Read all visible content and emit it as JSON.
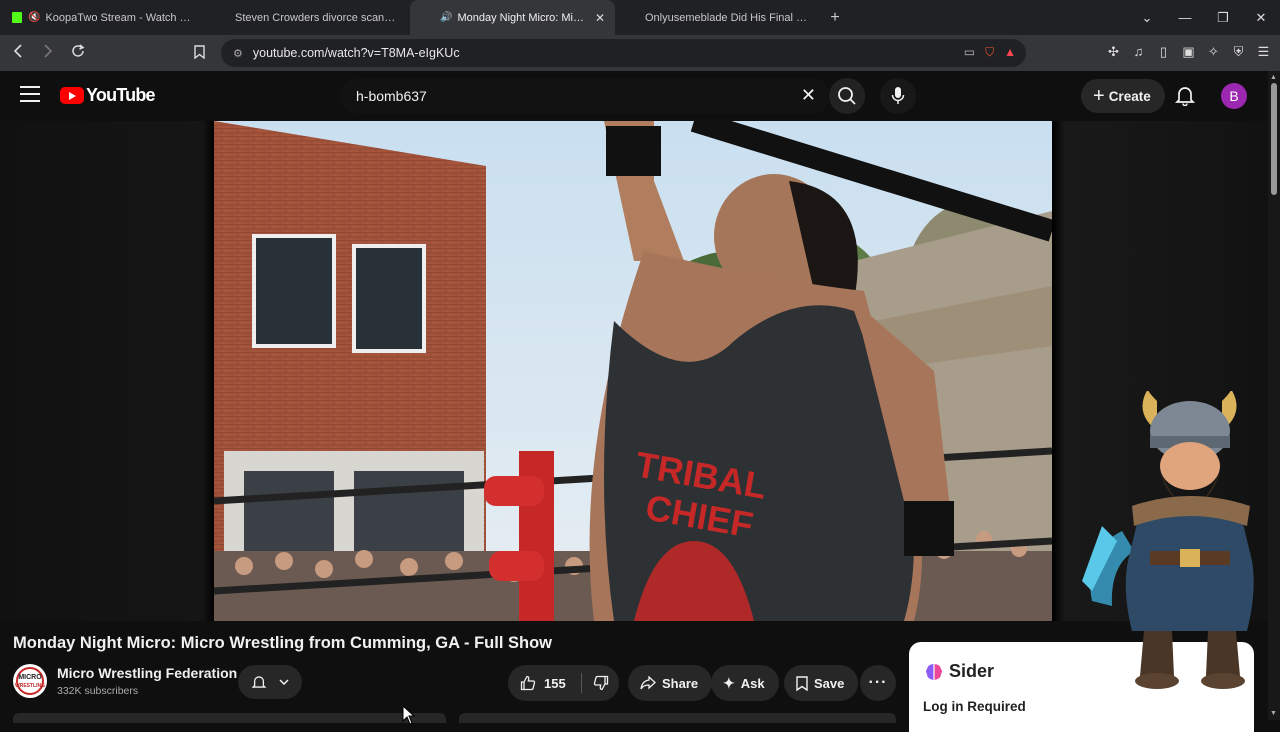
{
  "browser": {
    "tabs": [
      {
        "title": "KoopaTwo Stream - Watch Live on Kick",
        "favicon": "kick-icon",
        "muted": true,
        "active": false
      },
      {
        "title": "Steven Crowders divorce scandal | REACTION",
        "favicon": "youtube-icon",
        "active": false
      },
      {
        "title": "Monday Night Micro: Micro Wrestling from Cumming, GA - Full Show",
        "favicon": "youtube-icon",
        "audio": true,
        "active": true
      },
      {
        "title": "Onlyusemeblade Did His Final Litty Stream",
        "favicon": "youtube-icon",
        "active": false
      }
    ],
    "url": "youtube.com/watch?v=T8MA-eIgKUc",
    "shield_badge": "99+"
  },
  "youtube": {
    "logo_text": "YouTube",
    "search_query": "h-bomb637",
    "create_label": "Create",
    "avatar_letter": "B",
    "video": {
      "title": "Monday Night Micro: Micro Wrestling from Cumming, GA - Full Show",
      "shirt_text_1": "TRIBAL",
      "shirt_text_2": "CHIEF"
    },
    "channel": {
      "name": "Micro Wrestling Federation",
      "subscribers": "332K subscribers",
      "logo_text_1": "MICRO",
      "logo_text_2": "WRESTLING"
    },
    "actions": {
      "likes": "155",
      "share": "Share",
      "ask": "Ask",
      "save": "Save"
    }
  },
  "sider": {
    "brand": "Sider",
    "login_text": "Log in Required"
  },
  "colors": {
    "youtube_red": "#ff0000",
    "avatar_purple": "#9c27b0",
    "chrome_dark": "#202124",
    "toolbar": "#35363a"
  }
}
